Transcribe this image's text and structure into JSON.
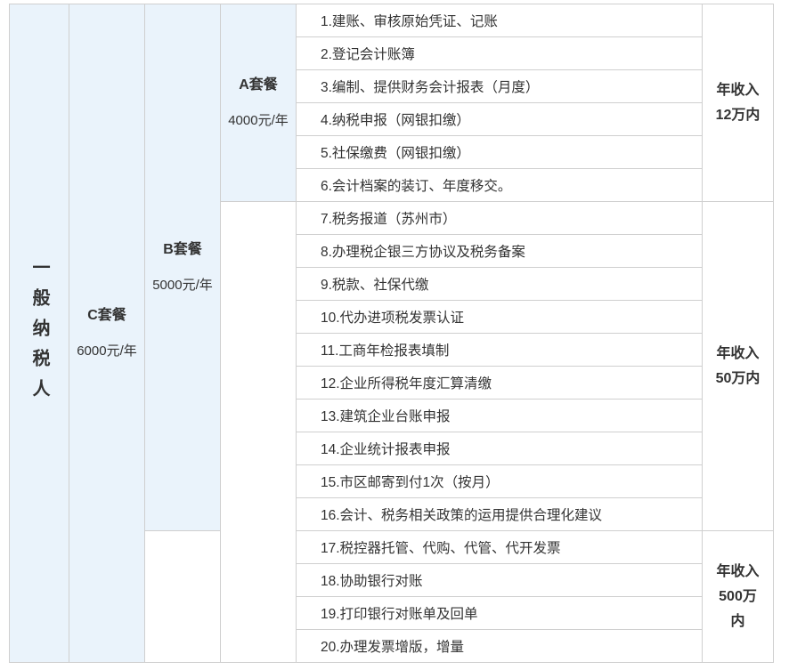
{
  "category": {
    "title": "一般纳税人"
  },
  "packages": {
    "c": {
      "name": "C套餐",
      "price": "6000元/年"
    },
    "b": {
      "name": "B套餐",
      "price": "5000元/年"
    },
    "a": {
      "name": "A套餐",
      "price": "4000元/年"
    }
  },
  "items": [
    "1.建账、审核原始凭证、记账",
    "2.登记会计账簿",
    "3.编制、提供财务会计报表（月度）",
    "4.纳税申报（网银扣缴）",
    "5.社保缴费（网银扣缴）",
    "6.会计档案的装订、年度移交。",
    "7.税务报道（苏州市）",
    "8.办理税企银三方协议及税务备案",
    "9.税款、社保代缴",
    "10.代办进项税发票认证",
    "11.工商年检报表填制",
    "12.企业所得税年度汇算清缴",
    "13.建筑企业台账申报",
    "14.企业统计报表申报",
    "15.市区邮寄到付1次（按月）",
    "16.会计、税务相关政策的运用提供合理化建议",
    "17.税控器托管、代购、代管、代开发票",
    "18.协助银行对账",
    "19.打印银行对账单及回单",
    "20.办理发票增版，增量"
  ],
  "incomes": {
    "first": [
      "年收入",
      "12万内"
    ],
    "second": [
      "年收入",
      "50万内"
    ],
    "third": [
      "年收入",
      "500万",
      "内"
    ]
  }
}
